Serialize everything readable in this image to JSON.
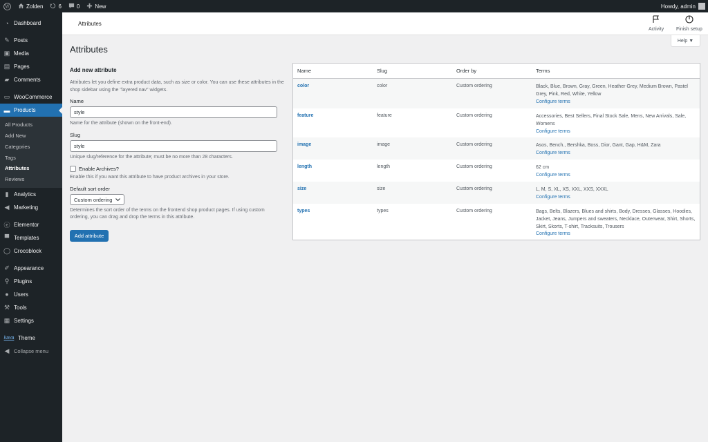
{
  "adminbar": {
    "site_name": "Zolden",
    "updates_count": "6",
    "comments_count": "0",
    "new_label": "New",
    "greeting": "Howdy, admin"
  },
  "sidebar": {
    "items": [
      {
        "label": "Dashboard",
        "icon": "dashboard-icon"
      },
      {
        "label": "Posts",
        "icon": "pin-icon"
      },
      {
        "label": "Media",
        "icon": "media-icon"
      },
      {
        "label": "Pages",
        "icon": "pages-icon"
      },
      {
        "label": "Comments",
        "icon": "comment-icon"
      },
      {
        "label": "WooCommerce",
        "icon": "woocommerce-icon"
      },
      {
        "label": "Products",
        "icon": "products-icon"
      },
      {
        "label": "Analytics",
        "icon": "analytics-icon"
      },
      {
        "label": "Marketing",
        "icon": "megaphone-icon"
      },
      {
        "label": "Elementor",
        "icon": "elementor-icon"
      },
      {
        "label": "Templates",
        "icon": "folder-icon"
      },
      {
        "label": "Crocoblock",
        "icon": "crocoblock-icon"
      },
      {
        "label": "Appearance",
        "icon": "brush-icon"
      },
      {
        "label": "Plugins",
        "icon": "plugin-icon"
      },
      {
        "label": "Users",
        "icon": "users-icon"
      },
      {
        "label": "Tools",
        "icon": "wrench-icon"
      },
      {
        "label": "Settings",
        "icon": "settings-icon"
      },
      {
        "label": "Theme",
        "icon": "kava-logo-icon",
        "logo_text": "kava"
      },
      {
        "label": "Collapse menu",
        "icon": "collapse-icon"
      }
    ],
    "submenu": [
      "All Products",
      "Add New",
      "Categories",
      "Tags",
      "Attributes",
      "Reviews"
    ]
  },
  "header": {
    "breadcrumb": "Attributes",
    "activity_label": "Activity",
    "finish_setup_label": "Finish setup",
    "help_label": "Help ▼"
  },
  "page": {
    "title": "Attributes"
  },
  "form": {
    "heading": "Add new attribute",
    "intro": "Attributes let you define extra product data, such as size or color. You can use these attributes in the shop sidebar using the \"layered nav\" widgets.",
    "name_label": "Name",
    "name_value": "style",
    "name_desc": "Name for the attribute (shown on the front-end).",
    "slug_label": "Slug",
    "slug_value": "style",
    "slug_desc": "Unique slug/reference for the attribute; must be no more than 28 characters.",
    "archives_label": "Enable Archives?",
    "archives_desc": "Enable this if you want this attribute to have product archives in your store.",
    "sort_label": "Default sort order",
    "sort_value": "Custom ordering",
    "sort_desc": "Determines the sort order of the terms on the frontend shop product pages. If using custom ordering, you can drag and drop the terms in this attribute.",
    "submit_label": "Add attribute"
  },
  "table": {
    "headers": [
      "Name",
      "Slug",
      "Order by",
      "Terms"
    ],
    "configure_label": "Configure terms",
    "rows": [
      {
        "name": "color",
        "slug": "color",
        "order": "Custom ordering",
        "terms": "Black, Blue, Brown, Gray, Green, Heather Grey, Medium Brown, Pastel Grey, Pink, Red, White, Yellow"
      },
      {
        "name": "feature",
        "slug": "feature",
        "order": "Custom ordering",
        "terms": "Accessories, Best Sellers, Final Stock Sale, Mens, New Arrivals, Sale, Womens"
      },
      {
        "name": "image",
        "slug": "image",
        "order": "Custom ordering",
        "terms": "Asos, Bench., Bershka, Boss, Dior, Gant, Gap, H&M, Zara"
      },
      {
        "name": "length",
        "slug": "length",
        "order": "Custom ordering",
        "terms": "62 cm"
      },
      {
        "name": "size",
        "slug": "size",
        "order": "Custom ordering",
        "terms": "L, M, S, XL, XS, XXL, XXS, XXXL"
      },
      {
        "name": "types",
        "slug": "types",
        "order": "Custom ordering",
        "terms": "Bags, Belts, Blazers, Blues and shirts, Body, Dresses, Glasses, Hoodies, Jacket, Jeans, Jumpers and sweaters, Necklace, Outerwear, Shirt, Shorts, Skirt, Skorts, T-shirt, Tracksuits, Trousers"
      }
    ]
  }
}
